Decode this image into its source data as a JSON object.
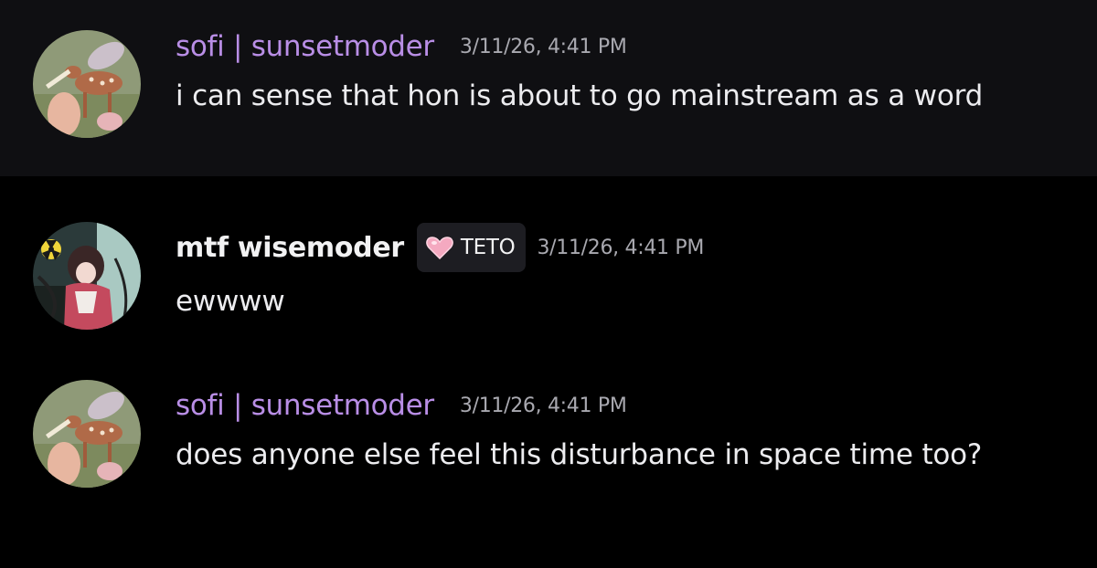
{
  "messages": [
    {
      "username": "sofi | sunsetmoder",
      "timestamp": "3/11/26, 4:41 PM",
      "content": "i can sense that hon is about to go mainstream as a word",
      "avatar_icon": "fawn-avatar-icon",
      "name_color": "#b98ee6"
    },
    {
      "username": "mtf wisemoder",
      "tag": {
        "icon": "pink-heart-icon",
        "label": "TETO"
      },
      "timestamp": "3/11/26, 4:41 PM",
      "content": "ewwww",
      "avatar_icon": "anime-character-avatar-icon",
      "name_color": "#f2f2f3"
    },
    {
      "username": "sofi | sunsetmoder",
      "timestamp": "3/11/26, 4:41 PM",
      "content": "does anyone else feel this disturbance in space time too?",
      "avatar_icon": "fawn-avatar-icon",
      "name_color": "#b98ee6"
    }
  ]
}
